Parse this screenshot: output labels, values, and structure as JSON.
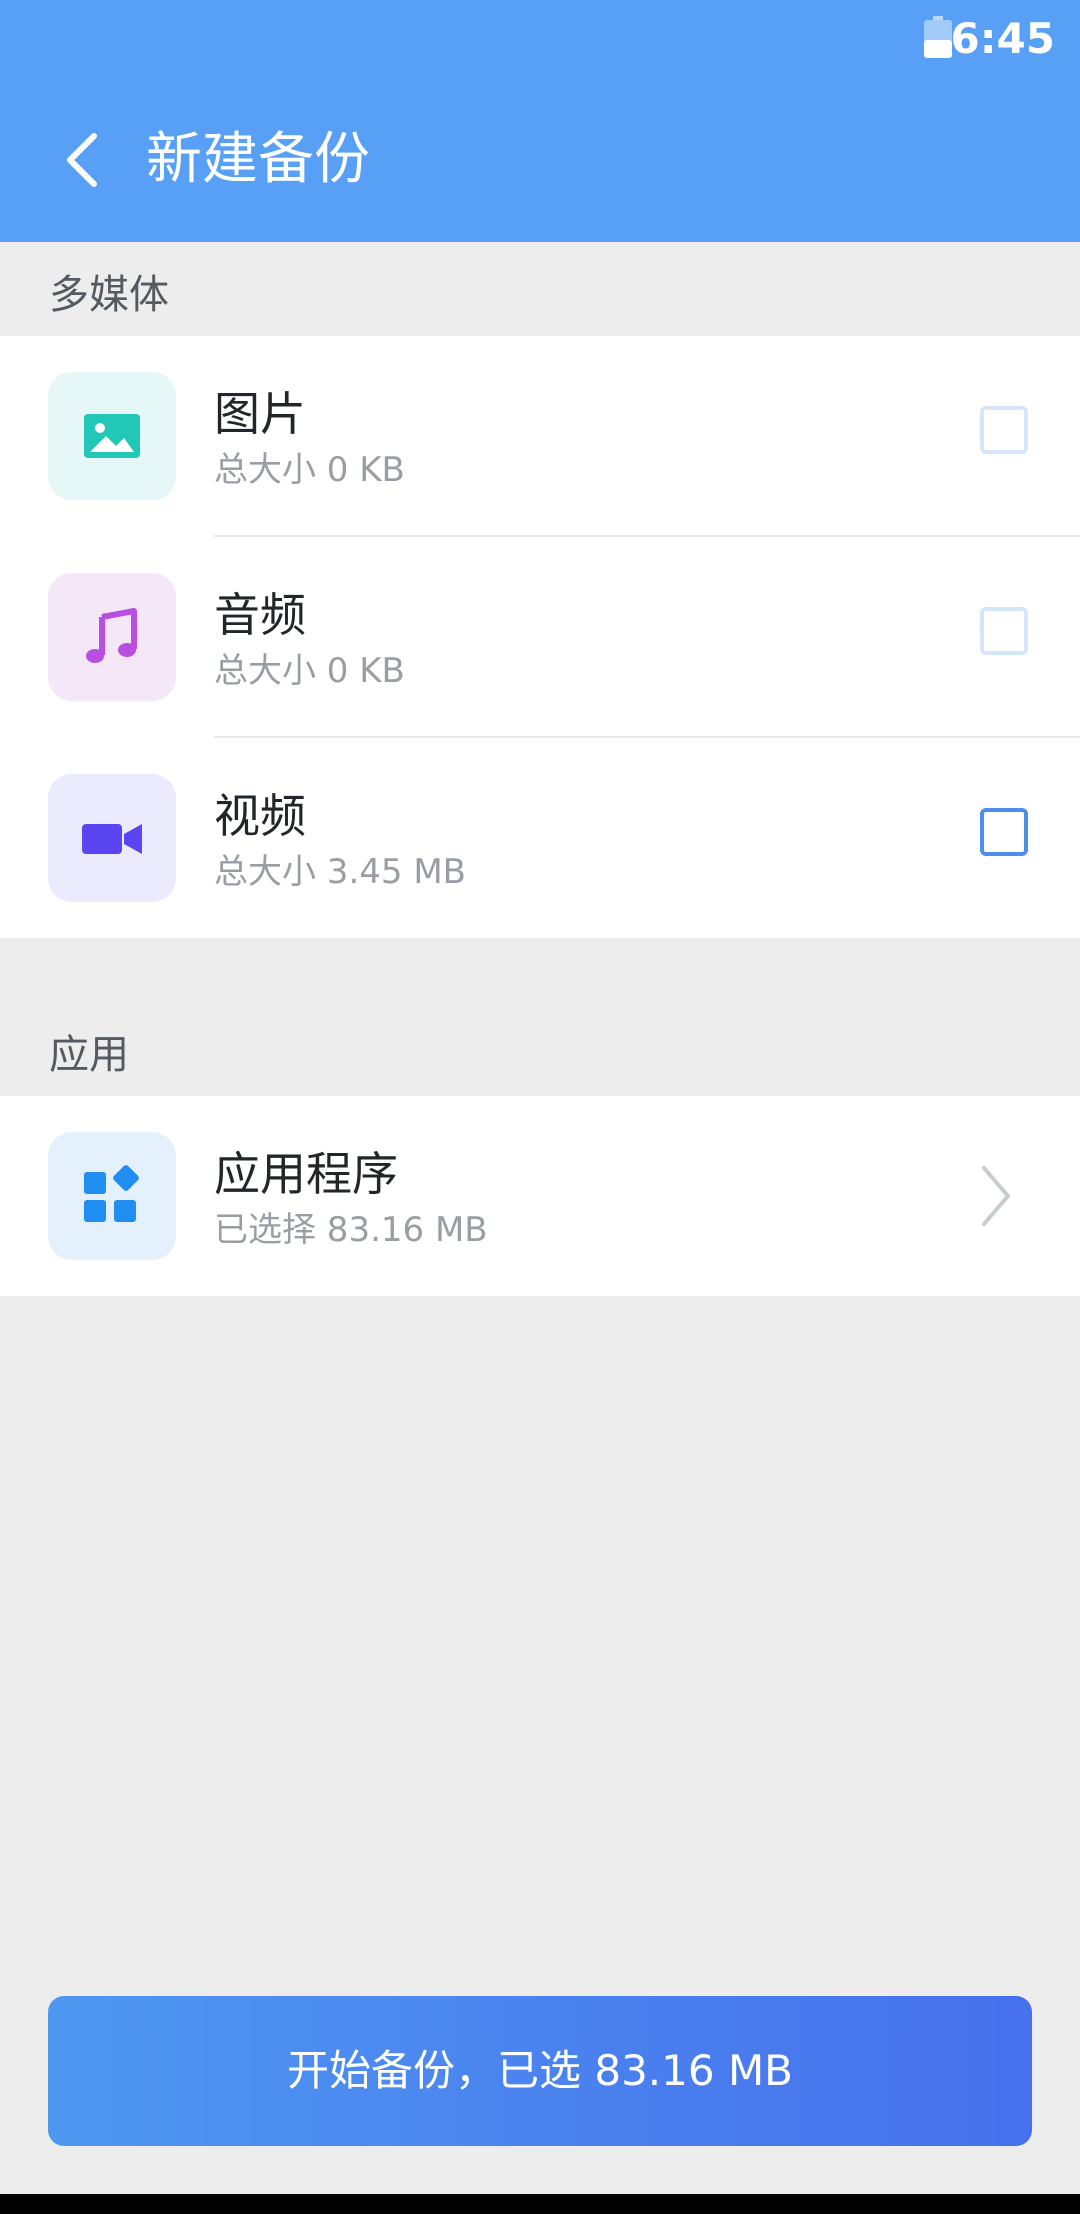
{
  "status_bar": {
    "time": "6:45"
  },
  "header": {
    "title": "新建备份"
  },
  "sections": {
    "media": {
      "label": "多媒体",
      "items": [
        {
          "title": "图片",
          "subtitle": "总大小 0 KB",
          "icon": "image-icon",
          "color": "#22c7b8",
          "bg": "#e6f7f7"
        },
        {
          "title": "音频",
          "subtitle": "总大小 0 KB",
          "icon": "music-note-icon",
          "color": "#b94fe0",
          "bg": "#f3e7f8"
        },
        {
          "title": "视频",
          "subtitle": "总大小 3.45 MB",
          "icon": "video-camera-icon",
          "color": "#5a45f0",
          "bg": "#ecebfd"
        }
      ]
    },
    "apps": {
      "label": "应用",
      "items": [
        {
          "title": "应用程序",
          "subtitle": "已选择 83.16 MB",
          "icon": "apps-icon",
          "color": "#1f8ef0",
          "bg": "#e5f0fd"
        }
      ]
    }
  },
  "action": {
    "start_label": "开始备份，已选 83.16 MB"
  },
  "colors": {
    "primary": "#57a0f6",
    "background": "#ededed"
  }
}
